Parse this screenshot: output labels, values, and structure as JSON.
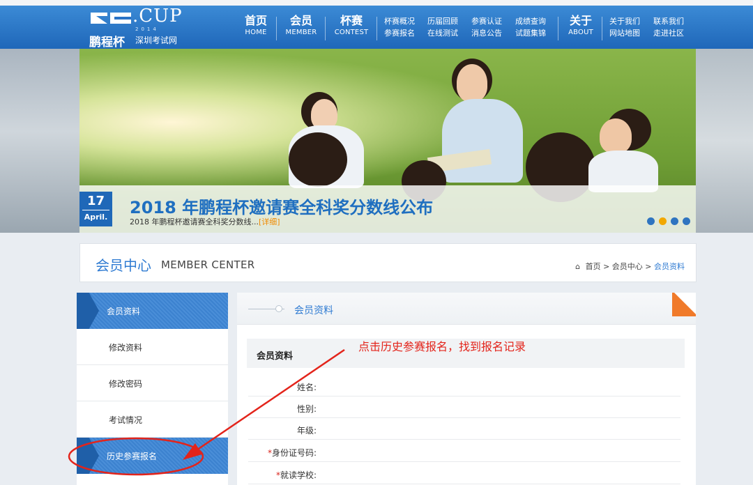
{
  "header": {
    "logo": {
      "brand": ".CUP",
      "year": "2014",
      "name": "鹏程杯",
      "subtitle": "深圳考试网"
    },
    "nav_main": [
      {
        "cn": "首页",
        "en": "HOME"
      },
      {
        "cn": "会员",
        "en": "MEMBER"
      },
      {
        "cn": "杯赛",
        "en": "CONTEST"
      }
    ],
    "nav_sub_contest": [
      [
        "杯赛概况",
        "参赛报名"
      ],
      [
        "历届回顾",
        "在线测试"
      ],
      [
        "参赛认证",
        "消息公告"
      ],
      [
        "成绩查询",
        "试题集锦"
      ]
    ],
    "nav_about": {
      "cn": "关于",
      "en": "ABOUT"
    },
    "nav_sub_about": [
      [
        "关于我们",
        "网站地图"
      ],
      [
        "联系我们",
        "走进社区"
      ]
    ]
  },
  "banner": {
    "date_day": "17",
    "date_month": "April.",
    "title": "2018 年鹏程杯邀请赛全科奖分数线公布",
    "summary": "2018 年鹏程杯邀请赛全科奖分数线...",
    "more_link": "[详细]",
    "slides_count": 4,
    "active_slide": 2
  },
  "member_center": {
    "title": "会员中心",
    "title_en": "MEMBER CENTER",
    "breadcrumb": [
      "首页",
      ">",
      "会员中心",
      ">",
      "会员资料"
    ]
  },
  "sidebar": {
    "items": [
      {
        "label": "会员资料",
        "active": true
      },
      {
        "label": "修改资料",
        "active": false
      },
      {
        "label": "修改密码",
        "active": false
      },
      {
        "label": "考试情况",
        "active": false
      },
      {
        "label": "历史参赛报名",
        "active": true
      }
    ]
  },
  "panel": {
    "title": "会员资料",
    "section_title": "会员资料",
    "fields": [
      {
        "label": "姓名:",
        "required": false
      },
      {
        "label": "性别:",
        "required": false
      },
      {
        "label": "年级:",
        "required": false
      },
      {
        "label": "身份证号码:",
        "required": true
      },
      {
        "label": "就读学校:",
        "required": true
      }
    ],
    "required_mark": "*"
  },
  "annotation": {
    "text": "点击历史参赛报名，找到报名记录",
    "color": "#e3241b"
  },
  "colors": {
    "brand_blue": "#1f68b8",
    "accent_orange": "#f2a800",
    "link_blue": "#2f7bd2"
  }
}
